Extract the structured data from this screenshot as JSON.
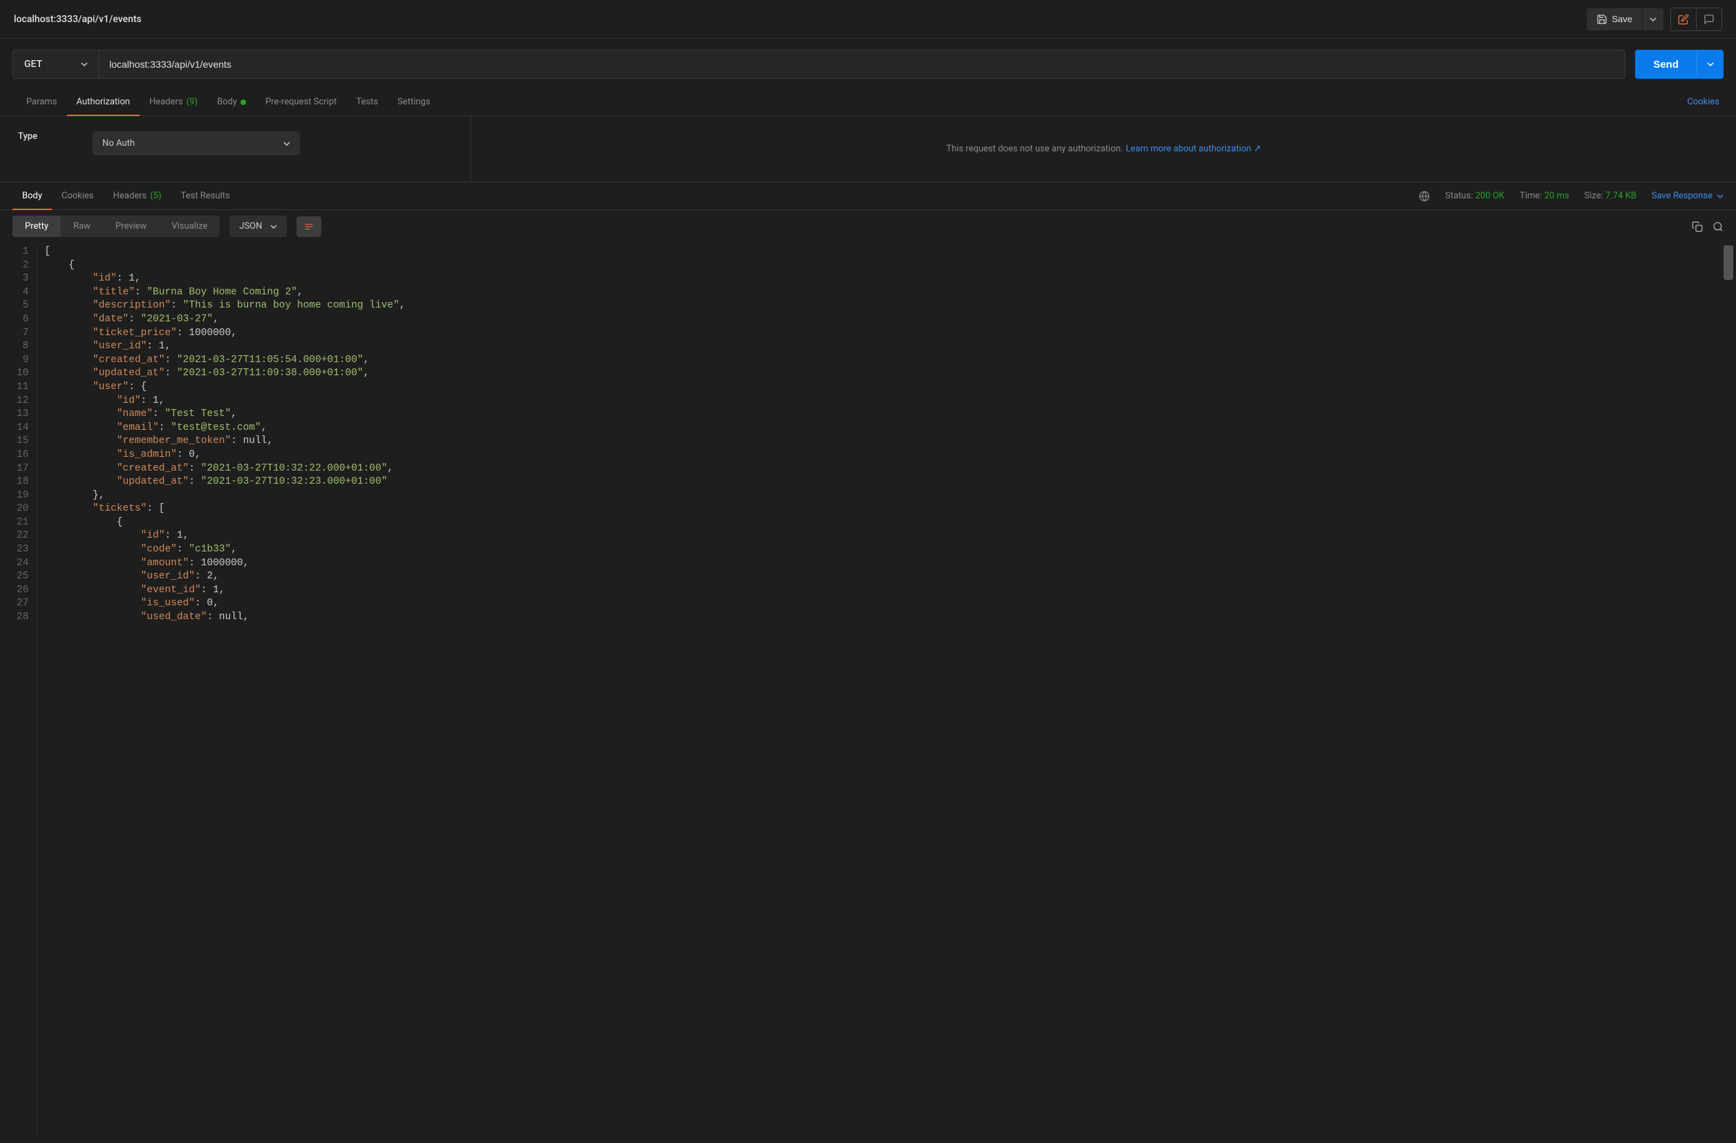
{
  "breadcrumb": "localhost:3333/api/v1/events",
  "save_label": "Save",
  "method": "GET",
  "url": "localhost:3333/api/v1/events",
  "send_label": "Send",
  "req_tabs": {
    "params": "Params",
    "authorization": "Authorization",
    "headers": "Headers",
    "headers_count": "(9)",
    "body": "Body",
    "prerequest": "Pre-request Script",
    "tests": "Tests",
    "settings": "Settings"
  },
  "cookies_link": "Cookies",
  "auth": {
    "type_label": "Type",
    "value": "No Auth",
    "message": "This request does not use any authorization.",
    "link": "Learn more about authorization ↗"
  },
  "res_tabs": {
    "body": "Body",
    "cookies": "Cookies",
    "headers": "Headers",
    "headers_count": "(5)",
    "test_results": "Test Results"
  },
  "status": {
    "status_label": "Status:",
    "status_value": "200 OK",
    "time_label": "Time:",
    "time_value": "20 ms",
    "size_label": "Size:",
    "size_value": "7.74 KB",
    "save_response": "Save Response"
  },
  "fmt": {
    "pretty": "Pretty",
    "raw": "Raw",
    "preview": "Preview",
    "visualize": "Visualize",
    "lang": "JSON"
  },
  "code_lines": [
    {
      "n": 1,
      "indent": 0,
      "tokens": [
        {
          "t": "punct",
          "v": "["
        }
      ]
    },
    {
      "n": 2,
      "indent": 1,
      "tokens": [
        {
          "t": "punct",
          "v": "{"
        }
      ]
    },
    {
      "n": 3,
      "indent": 2,
      "tokens": [
        {
          "t": "key",
          "v": "\"id\""
        },
        {
          "t": "punct",
          "v": ": "
        },
        {
          "t": "num",
          "v": "1"
        },
        {
          "t": "punct",
          "v": ","
        }
      ]
    },
    {
      "n": 4,
      "indent": 2,
      "tokens": [
        {
          "t": "key",
          "v": "\"title\""
        },
        {
          "t": "punct",
          "v": ": "
        },
        {
          "t": "str",
          "v": "\"Burna Boy Home Coming 2\""
        },
        {
          "t": "punct",
          "v": ","
        }
      ]
    },
    {
      "n": 5,
      "indent": 2,
      "tokens": [
        {
          "t": "key",
          "v": "\"description\""
        },
        {
          "t": "punct",
          "v": ": "
        },
        {
          "t": "str",
          "v": "\"This is burna boy home coming live\""
        },
        {
          "t": "punct",
          "v": ","
        }
      ]
    },
    {
      "n": 6,
      "indent": 2,
      "tokens": [
        {
          "t": "key",
          "v": "\"date\""
        },
        {
          "t": "punct",
          "v": ": "
        },
        {
          "t": "str",
          "v": "\"2021-03-27\""
        },
        {
          "t": "punct",
          "v": ","
        }
      ]
    },
    {
      "n": 7,
      "indent": 2,
      "tokens": [
        {
          "t": "key",
          "v": "\"ticket_price\""
        },
        {
          "t": "punct",
          "v": ": "
        },
        {
          "t": "num",
          "v": "1000000"
        },
        {
          "t": "punct",
          "v": ","
        }
      ]
    },
    {
      "n": 8,
      "indent": 2,
      "tokens": [
        {
          "t": "key",
          "v": "\"user_id\""
        },
        {
          "t": "punct",
          "v": ": "
        },
        {
          "t": "num",
          "v": "1"
        },
        {
          "t": "punct",
          "v": ","
        }
      ]
    },
    {
      "n": 9,
      "indent": 2,
      "tokens": [
        {
          "t": "key",
          "v": "\"created_at\""
        },
        {
          "t": "punct",
          "v": ": "
        },
        {
          "t": "str",
          "v": "\"2021-03-27T11:05:54.000+01:00\""
        },
        {
          "t": "punct",
          "v": ","
        }
      ]
    },
    {
      "n": 10,
      "indent": 2,
      "tokens": [
        {
          "t": "key",
          "v": "\"updated_at\""
        },
        {
          "t": "punct",
          "v": ": "
        },
        {
          "t": "str",
          "v": "\"2021-03-27T11:09:38.000+01:00\""
        },
        {
          "t": "punct",
          "v": ","
        }
      ]
    },
    {
      "n": 11,
      "indent": 2,
      "tokens": [
        {
          "t": "key",
          "v": "\"user\""
        },
        {
          "t": "punct",
          "v": ": {"
        }
      ]
    },
    {
      "n": 12,
      "indent": 3,
      "tokens": [
        {
          "t": "key",
          "v": "\"id\""
        },
        {
          "t": "punct",
          "v": ": "
        },
        {
          "t": "num",
          "v": "1"
        },
        {
          "t": "punct",
          "v": ","
        }
      ]
    },
    {
      "n": 13,
      "indent": 3,
      "tokens": [
        {
          "t": "key",
          "v": "\"name\""
        },
        {
          "t": "punct",
          "v": ": "
        },
        {
          "t": "str",
          "v": "\"Test Test\""
        },
        {
          "t": "punct",
          "v": ","
        }
      ]
    },
    {
      "n": 14,
      "indent": 3,
      "tokens": [
        {
          "t": "key",
          "v": "\"email\""
        },
        {
          "t": "punct",
          "v": ": "
        },
        {
          "t": "str",
          "v": "\"test@test.com\""
        },
        {
          "t": "punct",
          "v": ","
        }
      ]
    },
    {
      "n": 15,
      "indent": 3,
      "tokens": [
        {
          "t": "key",
          "v": "\"remember_me_token\""
        },
        {
          "t": "punct",
          "v": ": "
        },
        {
          "t": "null",
          "v": "null"
        },
        {
          "t": "punct",
          "v": ","
        }
      ]
    },
    {
      "n": 16,
      "indent": 3,
      "tokens": [
        {
          "t": "key",
          "v": "\"is_admin\""
        },
        {
          "t": "punct",
          "v": ": "
        },
        {
          "t": "num",
          "v": "0"
        },
        {
          "t": "punct",
          "v": ","
        }
      ]
    },
    {
      "n": 17,
      "indent": 3,
      "tokens": [
        {
          "t": "key",
          "v": "\"created_at\""
        },
        {
          "t": "punct",
          "v": ": "
        },
        {
          "t": "str",
          "v": "\"2021-03-27T10:32:22.000+01:00\""
        },
        {
          "t": "punct",
          "v": ","
        }
      ]
    },
    {
      "n": 18,
      "indent": 3,
      "tokens": [
        {
          "t": "key",
          "v": "\"updated_at\""
        },
        {
          "t": "punct",
          "v": ": "
        },
        {
          "t": "str",
          "v": "\"2021-03-27T10:32:23.000+01:00\""
        }
      ]
    },
    {
      "n": 19,
      "indent": 2,
      "tokens": [
        {
          "t": "punct",
          "v": "},"
        }
      ]
    },
    {
      "n": 20,
      "indent": 2,
      "tokens": [
        {
          "t": "key",
          "v": "\"tickets\""
        },
        {
          "t": "punct",
          "v": ": ["
        }
      ]
    },
    {
      "n": 21,
      "indent": 3,
      "tokens": [
        {
          "t": "punct",
          "v": "{"
        }
      ]
    },
    {
      "n": 22,
      "indent": 4,
      "tokens": [
        {
          "t": "key",
          "v": "\"id\""
        },
        {
          "t": "punct",
          "v": ": "
        },
        {
          "t": "num",
          "v": "1"
        },
        {
          "t": "punct",
          "v": ","
        }
      ]
    },
    {
      "n": 23,
      "indent": 4,
      "tokens": [
        {
          "t": "key",
          "v": "\"code\""
        },
        {
          "t": "punct",
          "v": ": "
        },
        {
          "t": "str",
          "v": "\"c1b33\""
        },
        {
          "t": "punct",
          "v": ","
        }
      ]
    },
    {
      "n": 24,
      "indent": 4,
      "tokens": [
        {
          "t": "key",
          "v": "\"amount\""
        },
        {
          "t": "punct",
          "v": ": "
        },
        {
          "t": "num",
          "v": "1000000"
        },
        {
          "t": "punct",
          "v": ","
        }
      ]
    },
    {
      "n": 25,
      "indent": 4,
      "tokens": [
        {
          "t": "key",
          "v": "\"user_id\""
        },
        {
          "t": "punct",
          "v": ": "
        },
        {
          "t": "num",
          "v": "2"
        },
        {
          "t": "punct",
          "v": ","
        }
      ]
    },
    {
      "n": 26,
      "indent": 4,
      "tokens": [
        {
          "t": "key",
          "v": "\"event_id\""
        },
        {
          "t": "punct",
          "v": ": "
        },
        {
          "t": "num",
          "v": "1"
        },
        {
          "t": "punct",
          "v": ","
        }
      ]
    },
    {
      "n": 27,
      "indent": 4,
      "tokens": [
        {
          "t": "key",
          "v": "\"is_used\""
        },
        {
          "t": "punct",
          "v": ": "
        },
        {
          "t": "num",
          "v": "0"
        },
        {
          "t": "punct",
          "v": ","
        }
      ]
    },
    {
      "n": 28,
      "indent": 4,
      "tokens": [
        {
          "t": "key",
          "v": "\"used_date\""
        },
        {
          "t": "punct",
          "v": ": "
        },
        {
          "t": "null",
          "v": "null"
        },
        {
          "t": "punct",
          "v": ","
        }
      ]
    }
  ]
}
